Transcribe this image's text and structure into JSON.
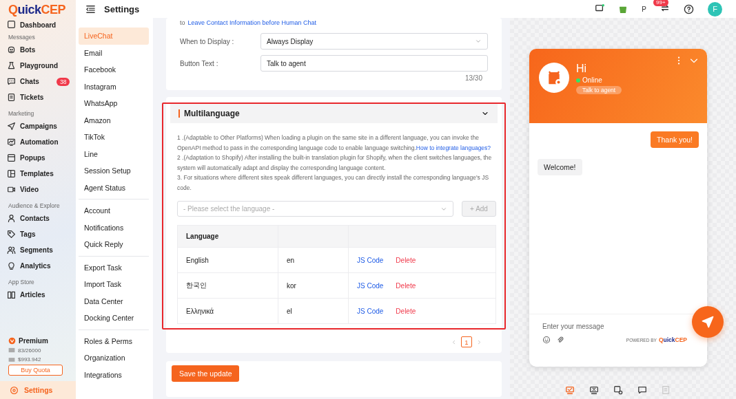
{
  "logo": {
    "first": "Q",
    "rest": "uick",
    "brand": "CEP"
  },
  "header": {
    "title": "Settings",
    "notice_badge": "99+",
    "partial_label": "P",
    "avatar": "F"
  },
  "sidebar": {
    "top_item": {
      "label": "Dashboard"
    },
    "groups": [
      {
        "heading": "Messages",
        "items": [
          {
            "label": "Bots",
            "selected": false
          },
          {
            "label": "Playground",
            "selected": false
          },
          {
            "label": "Chats",
            "selected": false,
            "badge": "38"
          },
          {
            "label": "Tickets",
            "selected": false
          }
        ]
      },
      {
        "heading": "Marketing",
        "items": [
          {
            "label": "Campaigns",
            "selected": false
          },
          {
            "label": "Automation",
            "selected": false
          },
          {
            "label": "Popups",
            "selected": false
          },
          {
            "label": "Templates",
            "selected": false
          },
          {
            "label": "Video",
            "selected": false
          }
        ]
      },
      {
        "heading": "Audience & Explore",
        "items": [
          {
            "label": "Contacts",
            "selected": false
          },
          {
            "label": "Tags",
            "selected": false
          },
          {
            "label": "Segments",
            "selected": false
          },
          {
            "label": "Analytics",
            "selected": false
          }
        ]
      },
      {
        "heading": "App Store",
        "items": [
          {
            "label": "Articles",
            "selected": false
          }
        ]
      }
    ],
    "plan": {
      "name": "Premium",
      "quota": "83/26000",
      "balance": "$993.942",
      "button": "Buy Quota"
    },
    "settings_item": {
      "label": "Settings",
      "selected": true
    }
  },
  "settings_menu": [
    [
      {
        "label": "LiveChat",
        "selected": true
      },
      {
        "label": "Email",
        "selected": false
      },
      {
        "label": "Facebook",
        "selected": false
      },
      {
        "label": "Instagram",
        "selected": false
      },
      {
        "label": "WhatsApp",
        "selected": false
      },
      {
        "label": "Amazon",
        "selected": false
      },
      {
        "label": "TikTok",
        "selected": false
      },
      {
        "label": "Line",
        "selected": false
      },
      {
        "label": "Session Setup",
        "selected": false
      },
      {
        "label": "Agent Status",
        "selected": false
      }
    ],
    [
      {
        "label": "Account",
        "selected": false
      },
      {
        "label": "Notifications",
        "selected": false
      },
      {
        "label": "Quick Reply",
        "selected": false
      }
    ],
    [
      {
        "label": "Export Task",
        "selected": false
      },
      {
        "label": "Import Task",
        "selected": false
      },
      {
        "label": "Data Center",
        "selected": false
      },
      {
        "label": "Docking Center",
        "selected": false
      }
    ],
    [
      {
        "label": "Roles & Perms",
        "selected": false
      },
      {
        "label": "Organization",
        "selected": false
      },
      {
        "label": "Integrations",
        "selected": false
      }
    ]
  ],
  "form": {
    "intro_prefix": "to",
    "intro_link": "Leave Contact Information before Human Chat",
    "fields": [
      {
        "kind": "select",
        "label": "When to Display :",
        "value": "Always Display"
      },
      {
        "kind": "text",
        "label": "Button Text :",
        "value": "Talk to agent",
        "counter": "13/30"
      }
    ]
  },
  "multilanguage": {
    "title": "Multilanguage",
    "expanded": true,
    "notes": [
      {
        "text": "1 .(Adaptable to Other Platforms) When loading a plugin on the same site in a different language, you can invoke the OpenAPI method to pass in the corresponding language code to enable language switching.",
        "link": "How to integrate languages?"
      },
      {
        "text": "2 .(Adaptation to Shopify) After installing the built-in translation plugin for Shopify, when the client switches languages, the system will automatically adapt and display the corresponding language content."
      },
      {
        "text": "3. For situations where different sites speak different languages, you can directly install the corresponding language's JS code."
      }
    ],
    "select_placeholder": "- Please select the language -",
    "add_button": {
      "label": "+ Add",
      "disabled": true
    },
    "table": {
      "columns": [
        "Language"
      ],
      "rows": [
        {
          "language": "English",
          "code": "en",
          "actions": [
            "JS Code",
            "Delete"
          ]
        },
        {
          "language": "한국인",
          "code": "kor",
          "actions": [
            "JS Code",
            "Delete"
          ]
        },
        {
          "language": "Ελληνικά",
          "code": "el",
          "actions": [
            "JS Code",
            "Delete"
          ]
        }
      ]
    },
    "pages": [
      {
        "label": "1",
        "selected": true
      }
    ]
  },
  "save_button": "Save the update",
  "chat": {
    "greeting": "Hi",
    "status": "Online",
    "online": true,
    "agent_button": "Talk to agent",
    "messages": [
      {
        "kind": "outgoing",
        "text": "Thank you!"
      },
      {
        "kind": "incoming",
        "text": "Welcome!"
      }
    ],
    "input_placeholder": "Enter your message",
    "powered_by": "POWERED BY",
    "powered_logo": {
      "first": "Q",
      "rest": "uick",
      "brand": "CEP"
    }
  },
  "preview_tools": [
    {
      "selected": true
    },
    {
      "selected": false
    },
    {
      "selected": false
    },
    {
      "selected": false
    },
    {
      "selected": false,
      "disabled": true
    }
  ]
}
